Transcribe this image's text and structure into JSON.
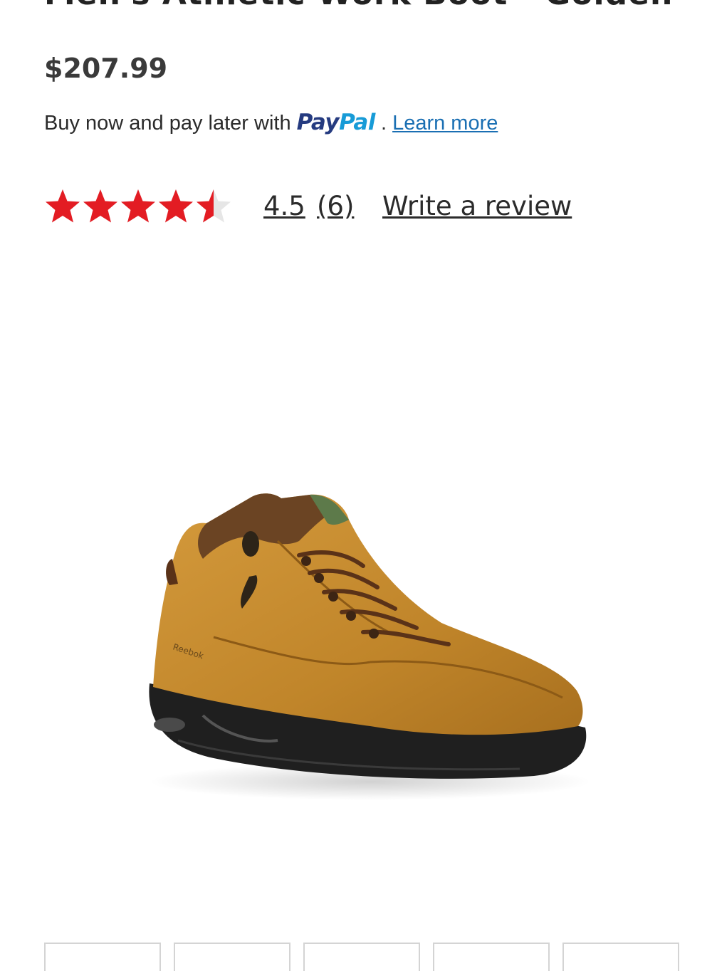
{
  "product": {
    "title": "Men's Athletic Work Boot - Golden Tan",
    "price": "$207.99"
  },
  "paylater": {
    "prefix": "Buy now and pay later with",
    "brand_pay": "Pay",
    "brand_pal": "Pal",
    "separator": ".",
    "learn_more": "Learn more"
  },
  "rating": {
    "value": "4.5",
    "stars_value": 4.5,
    "stars_max": 5,
    "count": "(6)",
    "write_review": "Write a review",
    "star_color": "#e31c23",
    "star_empty_color": "#e6e6e6"
  },
  "gallery": {
    "main_image_icon": "boot-image",
    "thumbnail_count": 5
  },
  "colors": {
    "paypal_dark": "#253b80",
    "paypal_light": "#179bd7",
    "link": "#1a6fb3"
  }
}
